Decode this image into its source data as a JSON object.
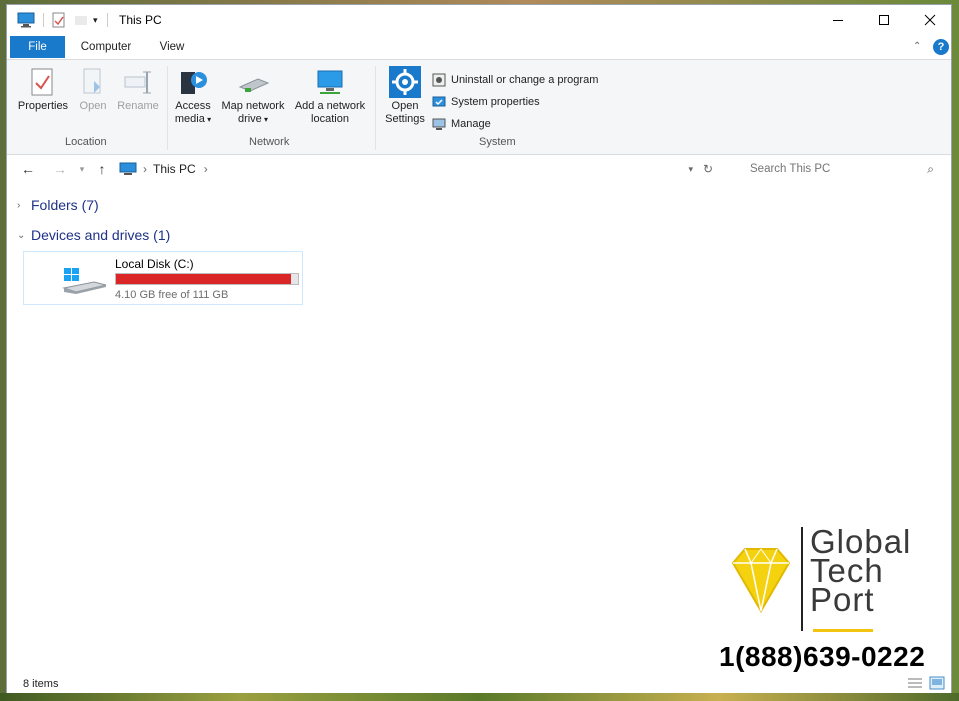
{
  "window": {
    "title": "This PC"
  },
  "ribbon_tabs": {
    "file": "File",
    "computer": "Computer",
    "view": "View"
  },
  "ribbon": {
    "location": {
      "label": "Location",
      "properties": "Properties",
      "open": "Open",
      "rename": "Rename"
    },
    "network": {
      "label": "Network",
      "access_media_1": "Access",
      "access_media_2": "media",
      "map_drive_1": "Map network",
      "map_drive_2": "drive",
      "add_location_1": "Add a network",
      "add_location_2": "location"
    },
    "system": {
      "label": "System",
      "open_settings_1": "Open",
      "open_settings_2": "Settings",
      "uninstall": "Uninstall or change a program",
      "system_properties": "System properties",
      "manage": "Manage"
    }
  },
  "address_bar": {
    "breadcrumb": "This PC",
    "search_placeholder": "Search This PC"
  },
  "sections": {
    "folders": "Folders (7)",
    "devices": "Devices and drives (1)"
  },
  "drive": {
    "name": "Local Disk (C:)",
    "free_text": "4.10 GB free of 111 GB",
    "used_fraction": 0.963,
    "bar_color": "#da2626"
  },
  "status_bar": {
    "items": "8 items"
  },
  "watermark": {
    "line1": "Global",
    "line2": "Tech",
    "line3": "Port",
    "phone": "1(888)639-0222",
    "accent": "#f2c40f"
  },
  "colors": {
    "accent": "#1979ca",
    "help": "#1979ca"
  }
}
